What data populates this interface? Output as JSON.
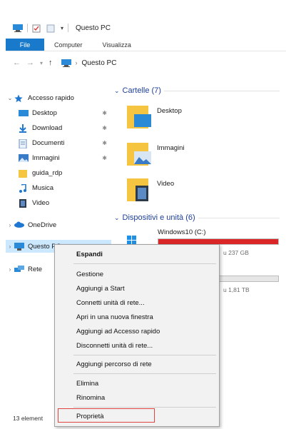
{
  "window": {
    "title": "Questo PC",
    "accent_color": "#1979ca"
  },
  "ribbon": {
    "tabs": [
      {
        "label": "File",
        "active": true
      },
      {
        "label": "Computer"
      },
      {
        "label": "Visualizza"
      }
    ]
  },
  "address": {
    "path": "Questo PC"
  },
  "nav": {
    "quick_access": {
      "label": "Accesso rapido",
      "icon": "star-icon"
    },
    "quick_items": [
      {
        "label": "Desktop",
        "icon": "desktop-icon",
        "pinned": true
      },
      {
        "label": "Download",
        "icon": "download-icon",
        "pinned": true
      },
      {
        "label": "Documenti",
        "icon": "document-icon",
        "pinned": true
      },
      {
        "label": "Immagini",
        "icon": "pictures-icon",
        "pinned": true
      },
      {
        "label": "guida_rdp",
        "icon": "folder-icon",
        "pinned": false
      },
      {
        "label": "Musica",
        "icon": "music-icon",
        "pinned": false
      },
      {
        "label": "Video",
        "icon": "video-icon",
        "pinned": false
      }
    ],
    "onedrive": {
      "label": "OneDrive",
      "icon": "cloud-icon"
    },
    "this_pc": {
      "label": "Questo PC",
      "icon": "computer-icon"
    },
    "network": {
      "label": "Rete",
      "icon": "network-icon"
    }
  },
  "content": {
    "folders_group": "Cartelle (7)",
    "folders": [
      {
        "name": "Desktop",
        "icon": "desktop-folder-icon"
      },
      {
        "name": "Immagini",
        "icon": "pictures-folder-icon"
      },
      {
        "name": "Video",
        "icon": "video-folder-icon"
      }
    ],
    "devices_group": "Dispositivi e unità (6)",
    "drives": [
      {
        "name": "Windows10 (C:)",
        "info": "u 237 GB",
        "fill_fraction": 1.0,
        "fill_color": "#da2626"
      },
      {
        "name": "",
        "info": "u 1,81 TB",
        "fill_fraction": 0.28,
        "fill_color": "#26a0da"
      }
    ]
  },
  "status": {
    "text": "13 element"
  },
  "context_menu": {
    "items": [
      {
        "label": "Espandi",
        "bold": true
      },
      {
        "label": "Gestione"
      },
      {
        "label": "Aggiungi a Start"
      },
      {
        "label": "Connetti unità di rete..."
      },
      {
        "label": "Apri in una nuova finestra"
      },
      {
        "label": "Aggiungi ad Accesso rapido"
      },
      {
        "label": "Disconnetti unità di rete..."
      },
      {
        "label": "Aggiungi percorso di rete"
      },
      {
        "label": "Elimina"
      },
      {
        "label": "Rinomina"
      },
      {
        "label": "Proprietà",
        "highlighted": true
      }
    ]
  }
}
